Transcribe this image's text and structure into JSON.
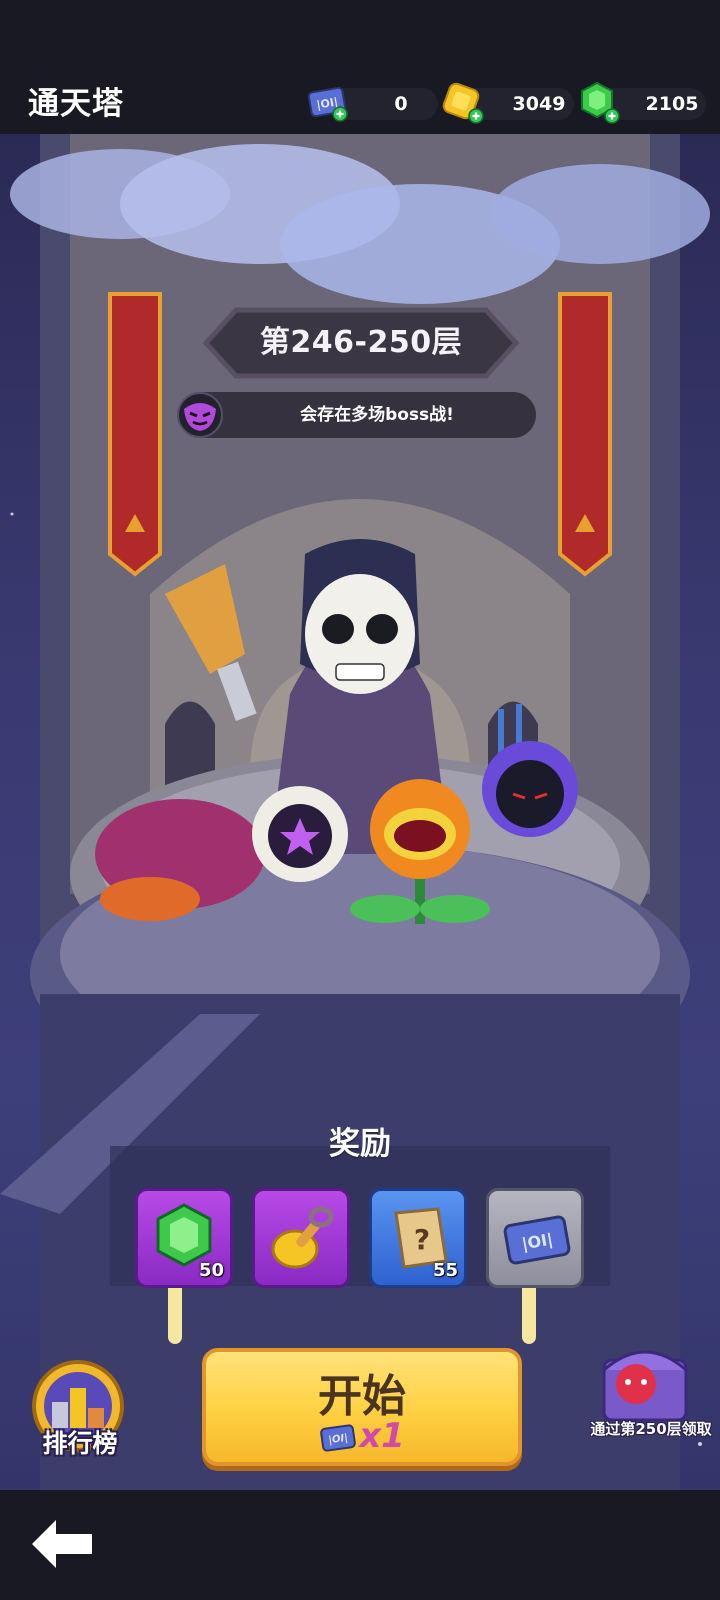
{
  "header": {
    "title": "通天塔",
    "currencies": [
      {
        "name": "ticket",
        "value": "0"
      },
      {
        "name": "gold",
        "value": "3049"
      },
      {
        "name": "gem",
        "value": "2105"
      }
    ]
  },
  "tower": {
    "floor_range": "第246-250层",
    "boss_notice": "会存在多场boss战!"
  },
  "rewards": {
    "label": "奖励",
    "items": [
      {
        "icon": "green-gem-icon",
        "count": "50",
        "frame": "purple"
      },
      {
        "icon": "gold-shovel-icon",
        "count": "",
        "frame": "purple"
      },
      {
        "icon": "mystery-scroll-icon",
        "count": "55",
        "frame": "blue"
      },
      {
        "icon": "tower-ticket-icon",
        "count": "",
        "frame": "gray"
      }
    ]
  },
  "start_button": {
    "label": "开始",
    "cost": "x1"
  },
  "leaderboard": {
    "label": "排行榜"
  },
  "chest": {
    "label": "通过第250层领取"
  },
  "colors": {
    "accent_yellow": "#ffd246",
    "frame_purple": "#a23ad6",
    "frame_blue": "#3f7ae6",
    "frame_gray": "#9a9aa6",
    "banner_red": "#b02a2a"
  }
}
